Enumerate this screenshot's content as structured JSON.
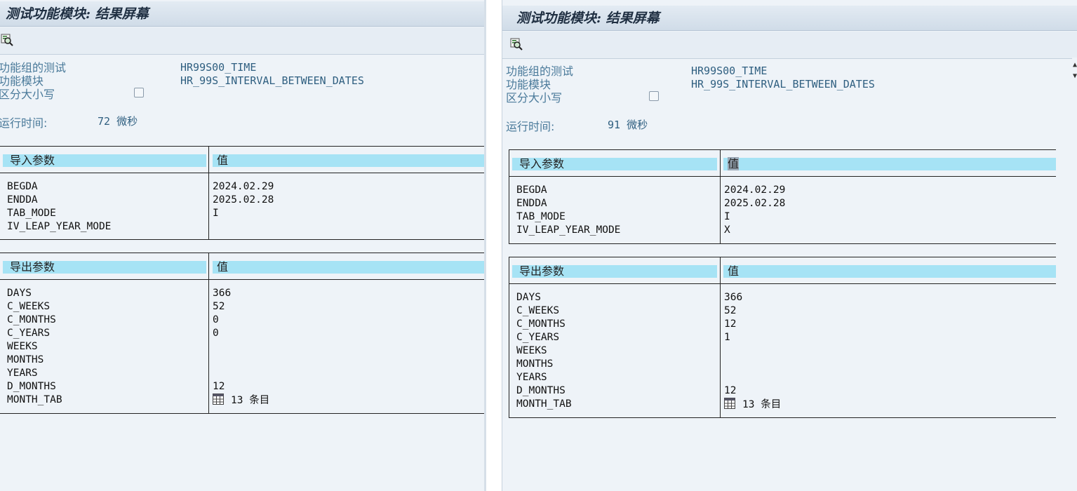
{
  "left": {
    "title": "测试功能模块: 结果屏幕",
    "toolbar": {
      "icon": "magnifier-detail-icon"
    },
    "info": {
      "group_label": "功能组的测试",
      "group_value": "HR99S00_TIME",
      "module_label": "功能模块",
      "module_value": "HR_99S_INTERVAL_BETWEEN_DATES",
      "case_label": "区分大小写",
      "case_checked": false
    },
    "runtime": {
      "label": "运行时间:",
      "value": "72 微秒"
    },
    "import": {
      "header_name": "导入参数",
      "header_value": "值",
      "rows": [
        {
          "name": "BEGDA",
          "value": "2024.02.29"
        },
        {
          "name": "ENDDA",
          "value": "2025.02.28"
        },
        {
          "name": "TAB_MODE",
          "value": "I"
        },
        {
          "name": "IV_LEAP_YEAR_MODE",
          "value": ""
        }
      ]
    },
    "export": {
      "header_name": "导出参数",
      "header_value": "值",
      "rows": [
        {
          "name": "DAYS",
          "value": "366"
        },
        {
          "name": "C_WEEKS",
          "value": "52"
        },
        {
          "name": "C_MONTHS",
          "value": "0"
        },
        {
          "name": "C_YEARS",
          "value": "0"
        },
        {
          "name": "WEEKS",
          "value": ""
        },
        {
          "name": "MONTHS",
          "value": ""
        },
        {
          "name": "YEARS",
          "value": ""
        },
        {
          "name": "D_MONTHS",
          "value": "12"
        },
        {
          "name": "MONTH_TAB",
          "value": "13 条目",
          "icon": "table-icon"
        }
      ]
    }
  },
  "right": {
    "title": "测试功能模块: 结果屏幕",
    "toolbar": {
      "icon": "magnifier-detail-icon"
    },
    "info": {
      "group_label": "功能组的测试",
      "group_value": "HR99S00_TIME",
      "module_label": "功能模块",
      "module_value": "HR_99S_INTERVAL_BETWEEN_DATES",
      "case_label": "区分大小写",
      "case_checked": false
    },
    "runtime": {
      "label": "运行时间:",
      "value": "91 微秒"
    },
    "import": {
      "header_name": "导入参数",
      "header_value": "值",
      "rows": [
        {
          "name": "BEGDA",
          "value": "2024.02.29"
        },
        {
          "name": "ENDDA",
          "value": "2025.02.28"
        },
        {
          "name": "TAB_MODE",
          "value": "I"
        },
        {
          "name": "IV_LEAP_YEAR_MODE",
          "value": "X"
        }
      ]
    },
    "export": {
      "header_name": "导出参数",
      "header_value": "值",
      "rows": [
        {
          "name": "DAYS",
          "value": "366"
        },
        {
          "name": "C_WEEKS",
          "value": "52"
        },
        {
          "name": "C_MONTHS",
          "value": "12"
        },
        {
          "name": "C_YEARS",
          "value": "1"
        },
        {
          "name": "WEEKS",
          "value": ""
        },
        {
          "name": "MONTHS",
          "value": ""
        },
        {
          "name": "YEARS",
          "value": ""
        },
        {
          "name": "D_MONTHS",
          "value": "12"
        },
        {
          "name": "MONTH_TAB",
          "value": "13 条目",
          "icon": "table-icon"
        }
      ]
    }
  }
}
